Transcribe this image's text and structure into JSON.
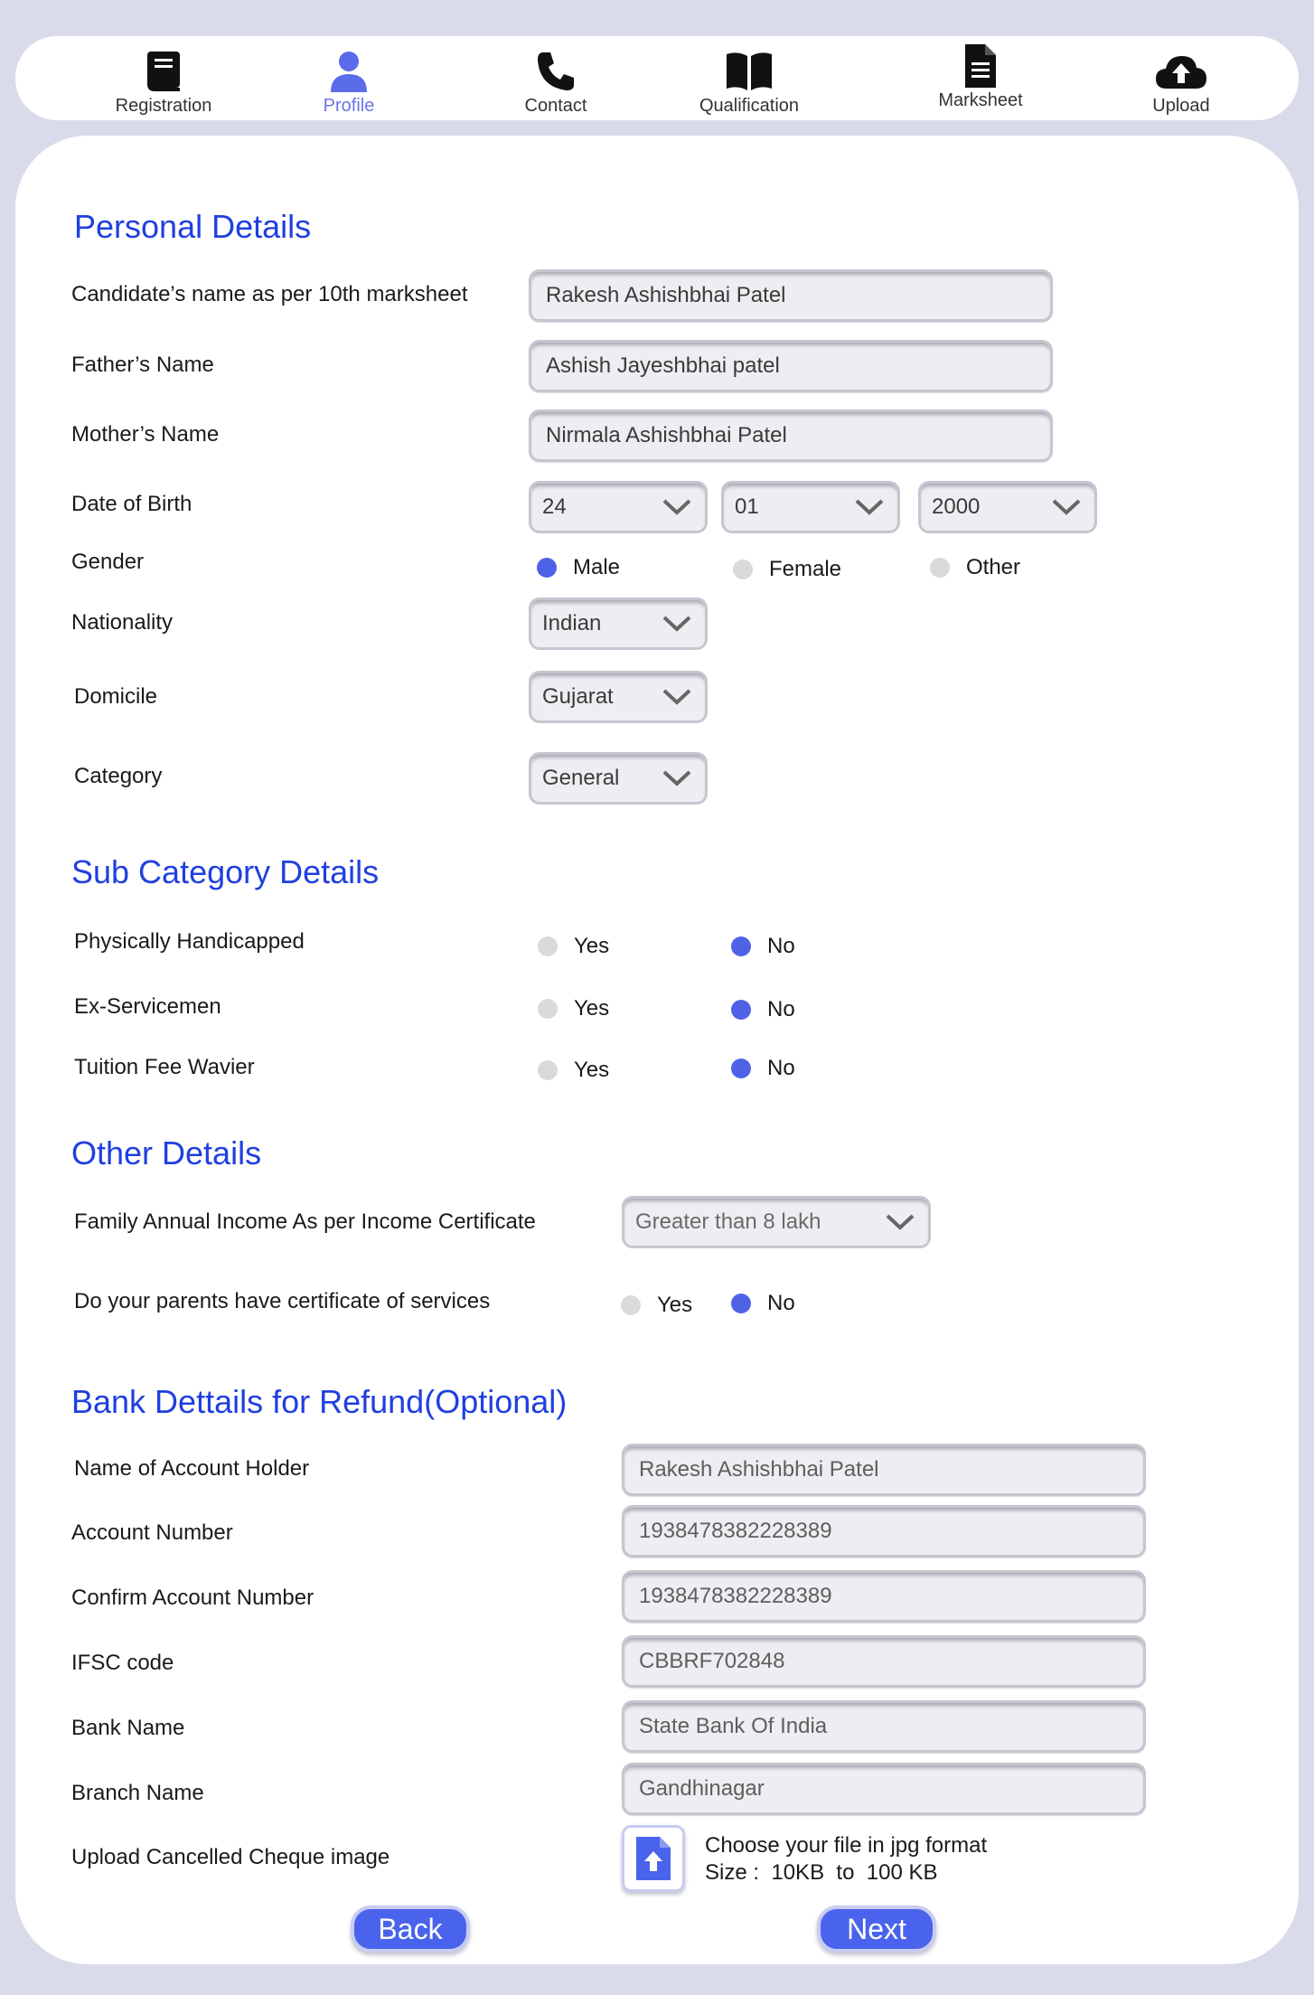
{
  "nav": {
    "items": [
      {
        "label": "Registration",
        "icon": "book-icon"
      },
      {
        "label": "Profile",
        "icon": "person-icon",
        "active": true
      },
      {
        "label": "Contact",
        "icon": "phone-icon"
      },
      {
        "label": "Qualification",
        "icon": "open-book-icon"
      },
      {
        "label": "Marksheet",
        "icon": "document-icon"
      },
      {
        "label": "Upload",
        "icon": "cloud-upload-icon"
      }
    ]
  },
  "personal": {
    "title": "Personal Details",
    "candidate_label": "Candidate’s name as per 10th marksheet",
    "candidate_value": "Rakesh Ashishbhai Patel",
    "father_label": "Father’s Name",
    "father_value": "Ashish Jayeshbhai patel",
    "mother_label": "Mother’s Name",
    "mother_value": "Nirmala Ashishbhai Patel",
    "dob_label": "Date of Birth",
    "dob_day": "24",
    "dob_month": "01",
    "dob_year": "2000",
    "gender_label": "Gender",
    "gender_options": [
      "Male",
      "Female",
      "Other"
    ],
    "gender_selected": "Male",
    "nationality_label": "Nationality",
    "nationality_value": "Indian",
    "domicile_label": "Domicile",
    "domicile_value": "Gujarat",
    "category_label": "Category",
    "category_value": "General"
  },
  "subcategory": {
    "title": "Sub Category Details",
    "yes": "Yes",
    "no": "No",
    "rows": [
      {
        "label": "Physically Handicapped",
        "selected": "No"
      },
      {
        "label": "Ex-Servicemen",
        "selected": "No"
      },
      {
        "label": "Tuition Fee Wavier",
        "selected": "No"
      }
    ]
  },
  "other": {
    "title": "Other Details",
    "income_label": "Family Annual Income As per Income Certificate",
    "income_value": "Greater than 8 lakh",
    "cert_label": "Do your parents have certificate of services",
    "cert_yes": "Yes",
    "cert_no": "No",
    "cert_selected": "No"
  },
  "bank": {
    "title": "Bank Dettails for Refund(Optional)",
    "holder_label": "Name of Account Holder",
    "holder_value": "Rakesh Ashishbhai Patel",
    "account_label": "Account Number",
    "account_value": "1938478382228389",
    "confirm_label": "Confirm Account Number",
    "confirm_value": "1938478382228389",
    "ifsc_label": "IFSC code",
    "ifsc_value": "CBBRF702848",
    "bankname_label": "Bank Name",
    "bankname_value": "State Bank Of India",
    "branch_label": "Branch Name",
    "branch_value": "Gandhinagar",
    "upload_label": "Upload Cancelled Cheque image",
    "upload_line1": "Choose your file in jpg format",
    "upload_line2": "Size :  10KB  to  100 KB"
  },
  "buttons": {
    "back": "Back",
    "next": "Next"
  },
  "colors": {
    "accent": "#4a63ec",
    "title": "#1f3fe0",
    "active_nav": "#6a75e8",
    "background": "#d9dbeb"
  }
}
